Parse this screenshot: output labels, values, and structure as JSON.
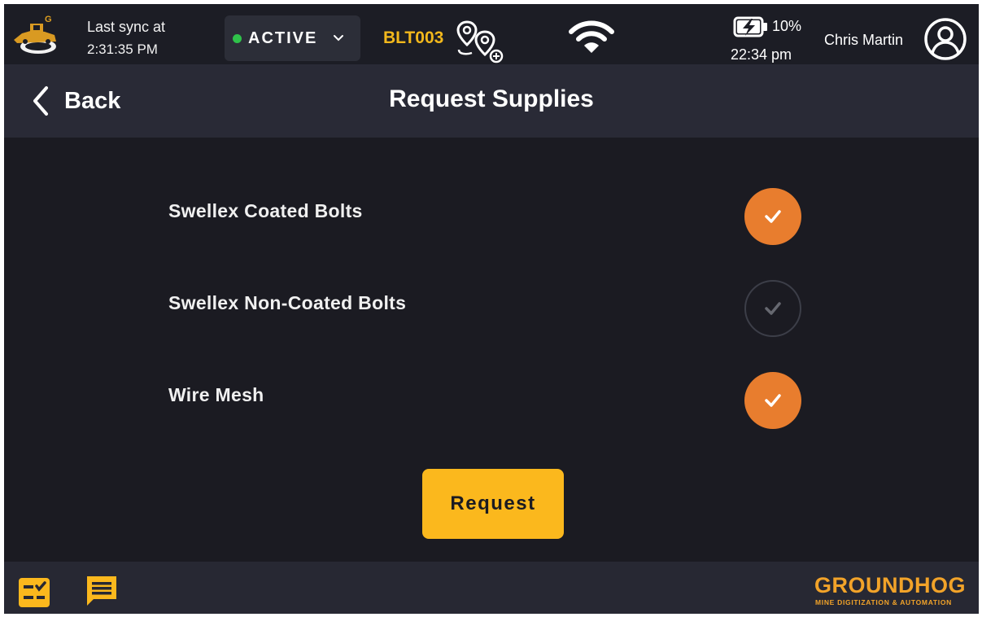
{
  "status_bar": {
    "sync_label": "Last sync at",
    "sync_time": "2:31:35 PM",
    "status": "ACTIVE",
    "status_color": "#2fc24a",
    "machine_id": "BLT003",
    "battery_percent": "10%",
    "clock": "22:34 pm",
    "user_name": "Chris Martin",
    "logo_letter": "G",
    "icons": [
      "machine-logo-icon",
      "chevron-down-icon",
      "route-pins-icon",
      "wifi-icon",
      "battery-charging-icon",
      "user-avatar-icon"
    ]
  },
  "header": {
    "back_label": "Back",
    "title": "Request Supplies"
  },
  "supplies": [
    {
      "label": "Swellex Coated Bolts",
      "checked": true
    },
    {
      "label": "Swellex Non-Coated Bolts",
      "checked": false
    },
    {
      "label": "Wire Mesh",
      "checked": true
    }
  ],
  "request_button_label": "Request",
  "footer": {
    "brand": "GROUNDHOG",
    "tagline": "MINE DIGITIZATION & AUTOMATION",
    "icons": [
      "checklist-icon",
      "message-icon"
    ]
  },
  "colors": {
    "accent_orange": "#e87d2e",
    "button_yellow": "#fbb81d",
    "machine_id_yellow": "#f2b81c",
    "brand_orange": "#f2a329",
    "background": "#1b1b22",
    "header_bg": "#292a36"
  }
}
